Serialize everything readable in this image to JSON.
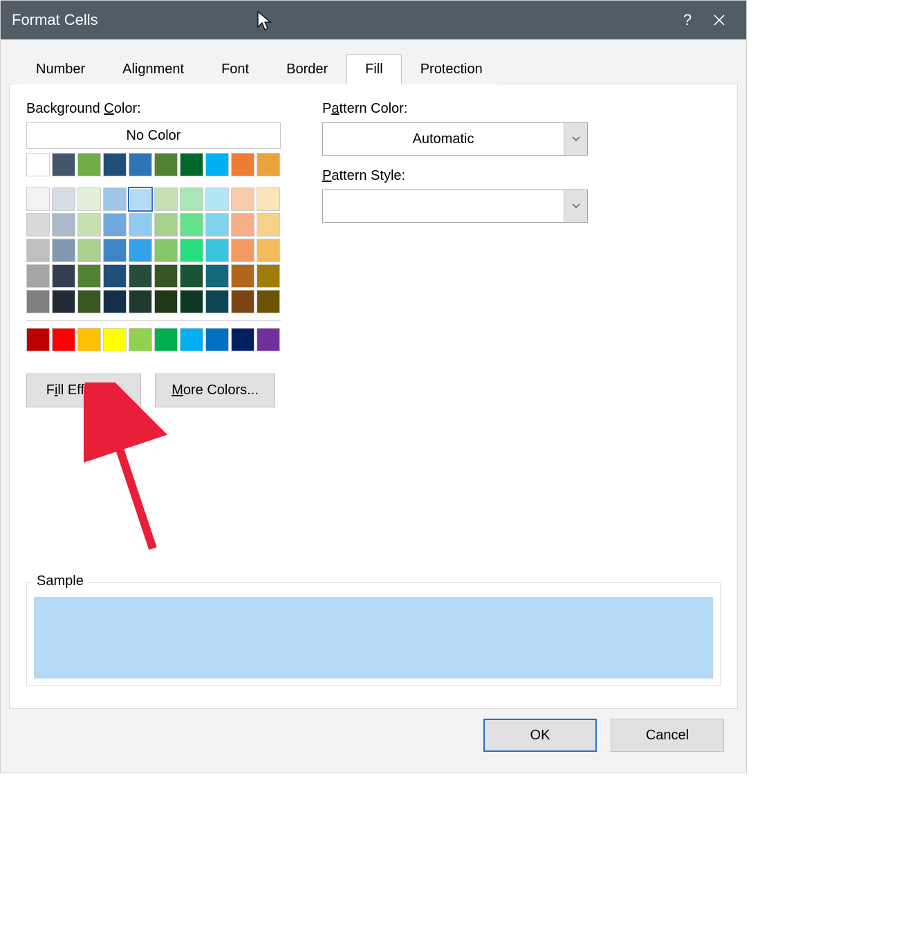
{
  "window": {
    "title": "Format Cells"
  },
  "tabs": [
    {
      "label": "Number",
      "active": false
    },
    {
      "label": "Alignment",
      "active": false
    },
    {
      "label": "Font",
      "active": false
    },
    {
      "label": "Border",
      "active": false
    },
    {
      "label": "Fill",
      "active": true
    },
    {
      "label": "Protection",
      "active": false
    }
  ],
  "labels": {
    "background_prefix": "Background ",
    "background_mn": "C",
    "background_suffix": "olor:",
    "nocolor": "No Color",
    "fill_effects_prefix": "F",
    "fill_effects_mn": "i",
    "fill_effects_suffix": "ll Effects...",
    "more_colors_mn": "M",
    "more_colors_suffix": "ore Colors...",
    "pattern_color_prefix": "P",
    "pattern_color_mn": "a",
    "pattern_color_suffix": "ttern Color:",
    "pattern_style_mn": "P",
    "pattern_style_suffix": "attern Style:",
    "sample": "Sample"
  },
  "pattern_color_value": "Automatic",
  "selected_color": "#B4DAF5",
  "sample_fill": "#B4DAF5",
  "footer": {
    "ok": "OK",
    "cancel": "Cancel"
  },
  "theme_row": [
    "#FFFFFF",
    "#44546A",
    "#70AD47",
    "#1F4E79",
    "#2E75B6",
    "#548235",
    "#00682B",
    "#00B0F0",
    "#ED7D31",
    "#E8A33D"
  ],
  "tint_rows": [
    [
      "#F2F2F2",
      "#D6DCE4",
      "#E2EFDA",
      "#9FC5E8",
      "#B4DAF5",
      "#C5E0B4",
      "#A8E6B8",
      "#B3E6F5",
      "#F8CBAD",
      "#FBE4B5"
    ],
    [
      "#D9D9D9",
      "#ACB9CA",
      "#C6E0B4",
      "#6FA8DC",
      "#8FCAF0",
      "#A9D08E",
      "#63E28E",
      "#7DD4EB",
      "#F4B084",
      "#F6D18A"
    ],
    [
      "#BFBFBF",
      "#8497B0",
      "#A9D08E",
      "#3D85C6",
      "#33A2EB",
      "#88C66B",
      "#26DE81",
      "#3CC3E0",
      "#F19B61",
      "#F2BC5E"
    ],
    [
      "#A6A6A6",
      "#333F4F",
      "#548235",
      "#1F4E79",
      "#264D3B",
      "#375623",
      "#195437",
      "#14687A",
      "#B2651D",
      "#9E7C0C"
    ],
    [
      "#808080",
      "#222A35",
      "#385723",
      "#132F49",
      "#1E3B2D",
      "#203816",
      "#0F3823",
      "#0D4652",
      "#7A4513",
      "#6B5408"
    ]
  ],
  "standard_row": [
    "#BE0000",
    "#FF0000",
    "#FFC000",
    "#FFFF00",
    "#92D050",
    "#00B050",
    "#00B0F0",
    "#0070C0",
    "#002060",
    "#7030A0"
  ]
}
